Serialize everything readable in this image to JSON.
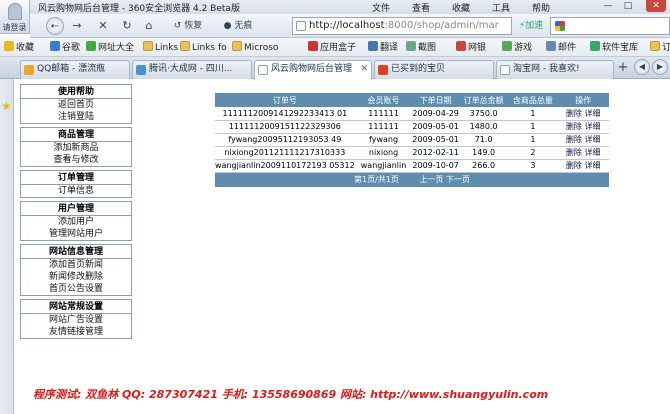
{
  "window": {
    "title": "风云购物网后台管理 - 360安全浏览器 4.2 Beta版",
    "login_label": "请登录",
    "menus": [
      "文件",
      "查看",
      "收藏",
      "工具",
      "帮助"
    ],
    "minimize": "—",
    "maximize": "□",
    "close": "✕"
  },
  "nav": {
    "back": "←",
    "forward": "→",
    "close_page": "✕",
    "refresh": "↻",
    "home": "⌂",
    "restore_label": "恢复",
    "no_trace_label": "无痕",
    "address": "http://localhost",
    "address_rest": ":8000/shop/admin/mar",
    "accelerate_label": "加速",
    "search_logo_icon": "google-icon"
  },
  "favorites": [
    "收藏",
    "谷歌",
    "网址大全",
    "Links",
    "Links fo",
    "Microso",
    "应用盒子",
    "翻译",
    "截图",
    "网银",
    "游戏",
    "邮件",
    "软件宝库",
    "订"
  ],
  "tabs": [
    {
      "label": "QQ邮箱 - 漂流瓶",
      "active": false
    },
    {
      "label": "腾讯·大成网 - 四川...",
      "active": false
    },
    {
      "label": "风云购物网后台管理",
      "active": true
    },
    {
      "label": "已买到的宝贝",
      "active": false
    },
    {
      "label": "淘宝网 - 我喜欢!",
      "active": false
    }
  ],
  "sidebar_menu": [
    {
      "title": "使用帮助",
      "items": [
        "返回首页",
        "注销登陆"
      ]
    },
    {
      "title": "商品管理",
      "items": [
        "添加新商品",
        "查看与修改"
      ]
    },
    {
      "title": "订单管理",
      "items": [
        "订单信息"
      ]
    },
    {
      "title": "用户管理",
      "items": [
        "添加用户",
        "管理网站用户"
      ]
    },
    {
      "title": "网站信息管理",
      "items": [
        "添加首页新闻",
        "新闻修改删除",
        "首页公告设置"
      ]
    },
    {
      "title": "网站常规设置",
      "items": [
        "网站广告设置",
        "友情链接管理"
      ]
    }
  ],
  "orders": {
    "headers": [
      "订单号",
      "会员账号",
      "下单日期",
      "订单总金额",
      "含商品总量",
      "操作"
    ],
    "rows": [
      {
        "id": "1111112009141292233413 01",
        "member": "111111",
        "date": "2009-04-29",
        "amount": "3750.0",
        "qty": "1",
        "delete": "删除",
        "detail": "详细"
      },
      {
        "id": "1111112009151122329306",
        "member": "111111",
        "date": "2009-05-01",
        "amount": "1480.0",
        "qty": "1",
        "delete": "删除",
        "detail": "详细"
      },
      {
        "id": "fywang20095112193053 49",
        "member": "fywang",
        "date": "2009-05-01",
        "amount": "71.0",
        "qty": "1",
        "delete": "删除",
        "detail": "详细"
      },
      {
        "id": "nixiong201121111217310333",
        "member": "nixiong",
        "date": "2012-02-11",
        "amount": "149.0",
        "qty": "2",
        "delete": "删除",
        "detail": "详细"
      },
      {
        "id": "wangjianlin2009110172193 05312",
        "member": "wangjianlin",
        "date": "2009-10-07",
        "amount": "266.0",
        "qty": "3",
        "delete": "删除",
        "detail": "详细"
      }
    ],
    "pager": {
      "info": "第1页/共1页",
      "prev": "上一页",
      "next": "下一页"
    }
  },
  "footer": "程序测试: 双鱼林   QQ: 287307421   手机: 13558690869   网站: http://www.shuangyulin.com"
}
